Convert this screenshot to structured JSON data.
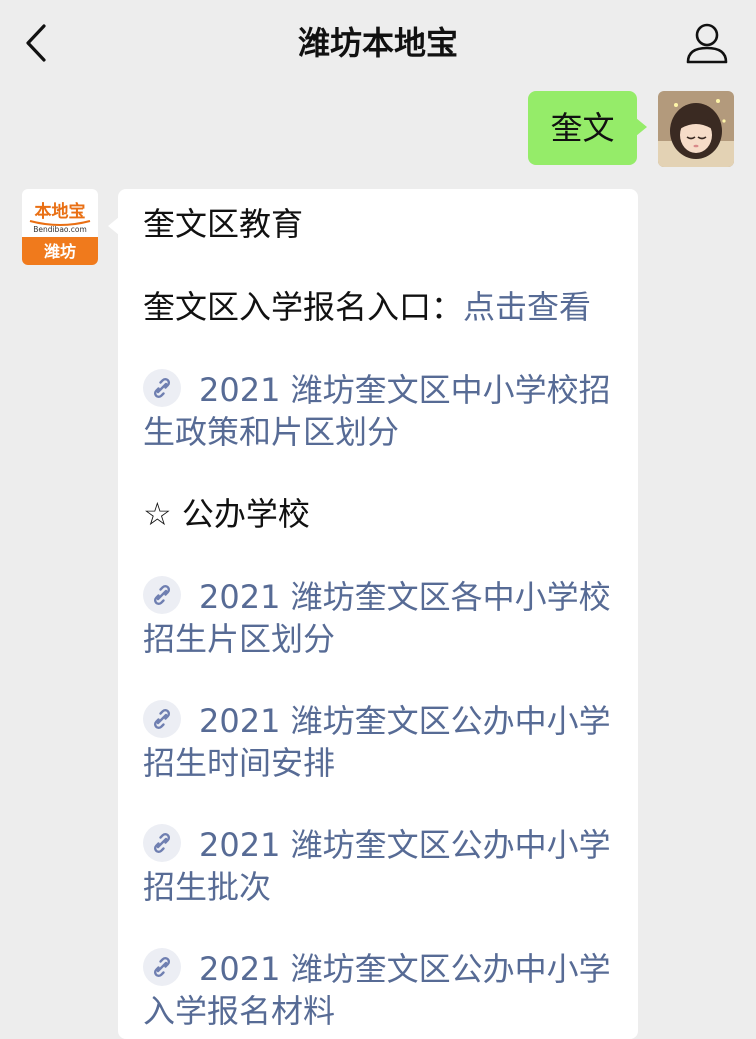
{
  "header": {
    "title": "潍坊本地宝"
  },
  "outgoing": {
    "text": "奎文"
  },
  "bot_logo": {
    "top_text": "本地宝",
    "domain_text": "Bendibao.com",
    "city_text": "潍坊"
  },
  "message": {
    "heading": "奎文区教育",
    "entry_label": "奎文区入学报名入口：",
    "entry_link": "点击查看",
    "links": [
      {
        "line1": "2021 潍坊奎文区中小学校招",
        "line2": "生政策和片区划分"
      },
      {
        "line1": "2021 潍坊奎文区各中小学校",
        "line2": "招生片区划分"
      },
      {
        "line1": "2021 潍坊奎文区公办中小学",
        "line2": "招生时间安排"
      },
      {
        "line1": "2021 潍坊奎文区公办中小学",
        "line2": "招生批次"
      },
      {
        "line1": "2021 潍坊奎文区公办中小学",
        "line2": "入学报名材料"
      }
    ],
    "section_star": "☆",
    "section_title": "公办学校"
  }
}
